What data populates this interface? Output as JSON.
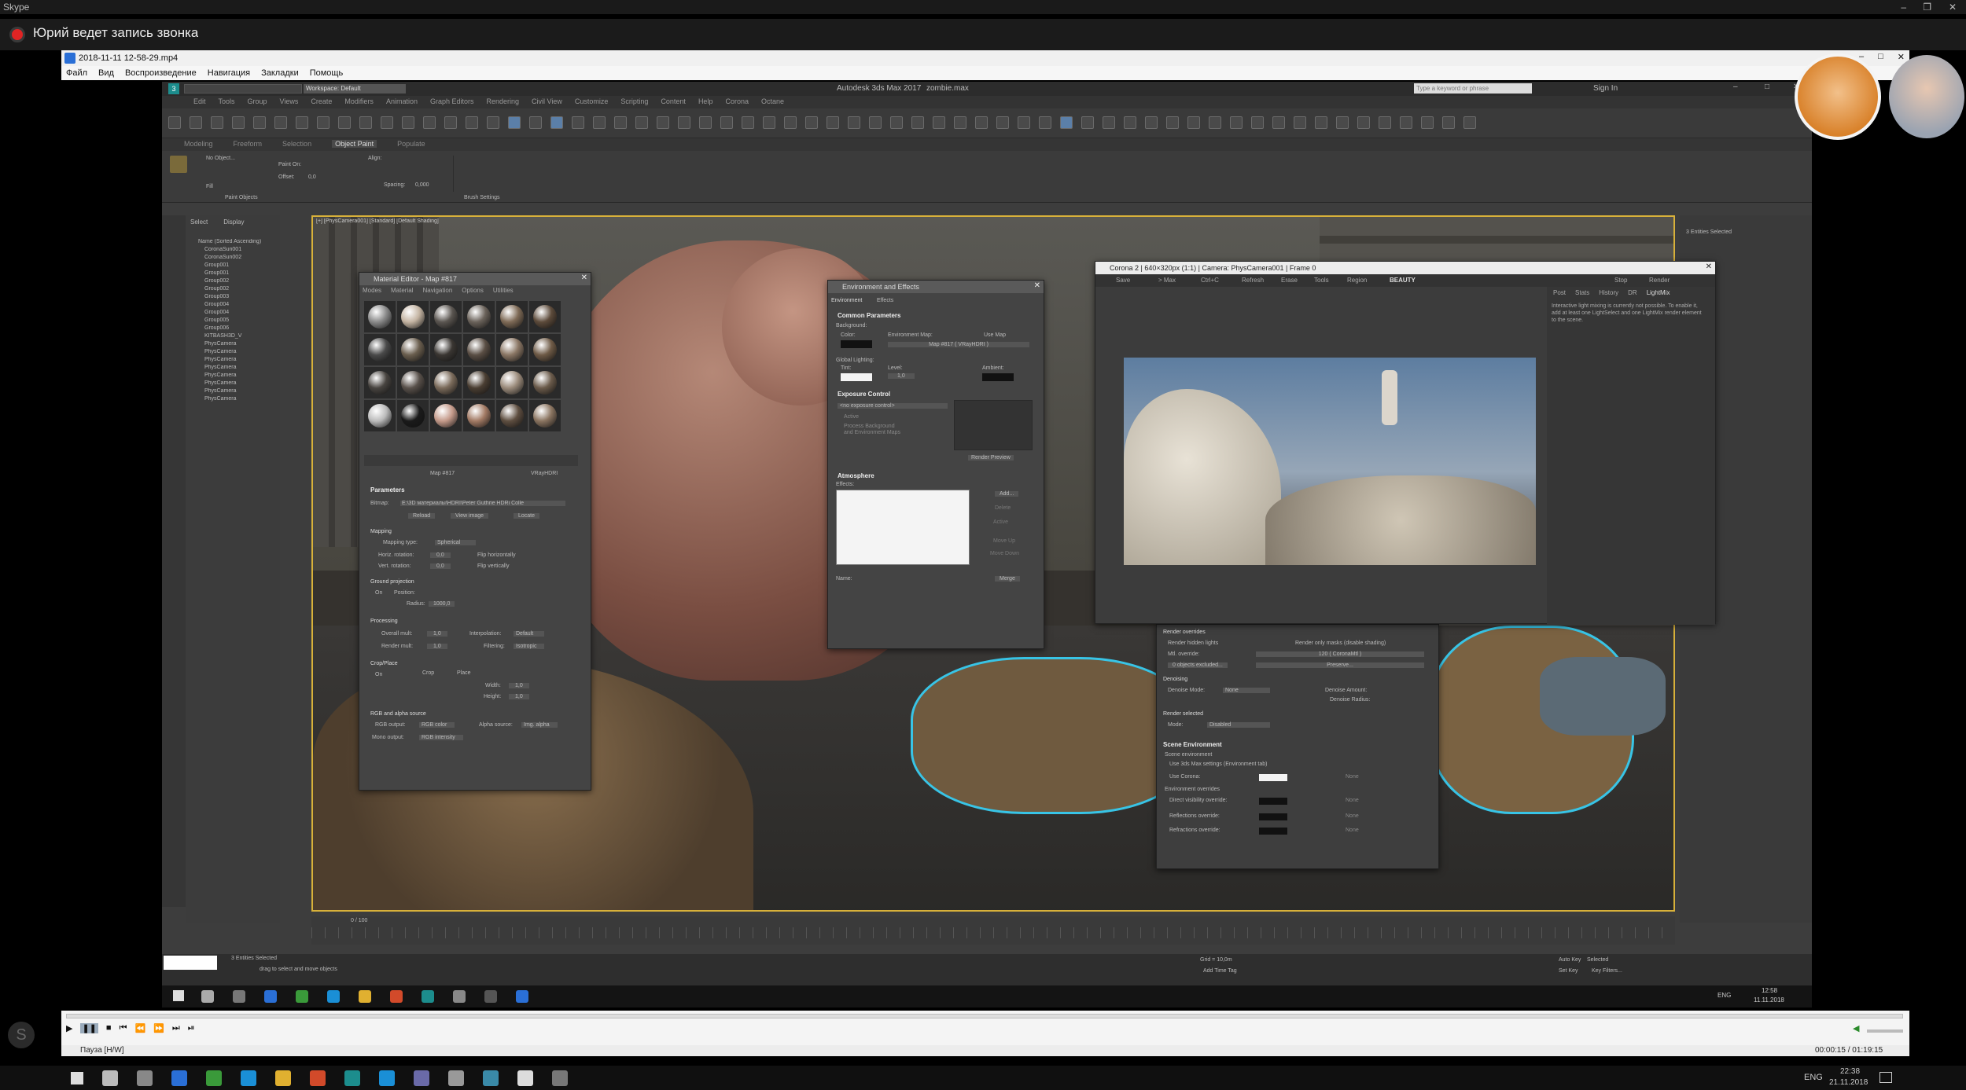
{
  "skype": {
    "title": "Skype",
    "recording_text": "Юрий ведет запись звонка"
  },
  "player": {
    "title": "2018-11-11 12-58-29.mp4",
    "menu": [
      "Файл",
      "Вид",
      "Воспроизведение",
      "Навигация",
      "Закладки",
      "Помощь"
    ],
    "status": "Пауза [H/W]",
    "time": "00:00:15 / 01:19:15"
  },
  "max": {
    "title": "Autodesk 3ds Max 2017",
    "file": "zombie.max",
    "workspace": "Workspace: Default",
    "search_placeholder": "Type a keyword or phrase",
    "sign_in": "Sign In",
    "menu": [
      "Edit",
      "Tools",
      "Group",
      "Views",
      "Create",
      "Modifiers",
      "Animation",
      "Graph Editors",
      "Rendering",
      "Civil View",
      "Customize",
      "Scripting",
      "Content",
      "Help",
      "Corona",
      "Octane"
    ],
    "ribbon_tabs": [
      "Modeling",
      "Freeform",
      "Selection",
      "Object Paint",
      "Populate"
    ],
    "ribbon_labels": {
      "no_object": "No Object...",
      "paint_on": "Paint On:",
      "offset": "Offset:",
      "offset_val": "0,0",
      "fill": "Fill",
      "align": "Align:",
      "spacing": "Spacing:",
      "spacing_val": "0,000",
      "paint_objects": "Paint Objects",
      "brush_settings": "Brush Settings"
    },
    "explorer": {
      "tabs": [
        "Select",
        "Display"
      ],
      "header": "Name (Sorted Ascending)",
      "items": [
        "CoronaSun001",
        "CoronaSun002",
        "Group001",
        "Group001",
        "Group002",
        "Group002",
        "Group003",
        "Group004",
        "Group004",
        "Group005",
        "Group006",
        "KITBASH3D_V",
        "PhysCamera",
        "PhysCamera",
        "PhysCamera",
        "PhysCamera",
        "PhysCamera",
        "PhysCamera",
        "PhysCamera",
        "PhysCamera"
      ]
    },
    "viewport_label": "[+] [PhysCamera001] [Standard] [Default Shading]",
    "status": {
      "selected": "3 Entities Selected",
      "hint": "drag to select and move objects",
      "grid": "Grid = 10,0m",
      "add_time_tag": "Add Time Tag",
      "auto_key": "Auto Key",
      "set_key": "Set Key",
      "selected_dd": "Selected",
      "key_filters": "Key Filters..."
    },
    "timeline_range": "0 / 100",
    "right_panel": {
      "header": "3 Entities Selected"
    }
  },
  "material_editor": {
    "title": "Material Editor - Map #817",
    "menu": [
      "Modes",
      "Material",
      "Navigation",
      "Options",
      "Utilities"
    ],
    "map_name": "Map #817",
    "map_type": "VRayHDRI",
    "section_params": "Parameters",
    "bitmap_label": "Bitmap:",
    "bitmap_path": "E:\\3D материалы\\HDRI\\Peter Guthrie HDRi Colle",
    "buttons": [
      "Reload",
      "View image",
      "Locate"
    ],
    "mapping": "Mapping",
    "mapping_type_label": "Mapping type:",
    "mapping_type": "Spherical",
    "horiz_rot": "Horiz. rotation:",
    "vert_rot": "Vert. rotation:",
    "flip_h": "Flip horizontally",
    "flip_v": "Flip vertically",
    "ground_projection": "Ground projection",
    "on": "On",
    "position": "Position:",
    "radius": "Radius:",
    "radius_val": "1000,0",
    "processing": "Processing",
    "overall_mult": "Overall mult:",
    "render_mult": "Render mult:",
    "interpolation": "Interpolation:",
    "interpolation_val": "Default",
    "filtering": "Filtering:",
    "filtering_val": "Isotropic",
    "crop_place": "Crop/Place",
    "crop": "Crop",
    "place": "Place",
    "width": "Width:",
    "height": "Height:",
    "rgb_alpha": "RGB and alpha source",
    "rgb_output": "RGB output:",
    "rgb_output_val": "RGB color",
    "alpha_source": "Alpha source:",
    "alpha_source_val": "Img. alpha",
    "mono_output": "Mono output:",
    "mono_output_val": "RGB intensity",
    "val_zero": "0,0",
    "val_one": "1,0"
  },
  "env_effects": {
    "title": "Environment and Effects",
    "tabs": [
      "Environment",
      "Effects"
    ],
    "common_params": "Common Parameters",
    "background": "Background:",
    "color": "Color:",
    "env_map": "Environment Map:",
    "use_map": "Use Map",
    "map_btn": "Map #817 ( VRayHDRI )",
    "global_lighting": "Global Lighting:",
    "tint": "Tint:",
    "level": "Level:",
    "level_val": "1,0",
    "ambient": "Ambient:",
    "exposure_control": "Exposure Control",
    "exposure_dd": "<no exposure control>",
    "active": "Active",
    "process_bg": "Process Background",
    "and_env": "and Environment Maps",
    "render_preview": "Render Preview",
    "atmosphere": "Atmosphere",
    "effects": "Effects:",
    "atm_buttons": [
      "Add...",
      "Delete",
      "Active",
      "Move Up",
      "Move Down"
    ],
    "name": "Name:",
    "merge": "Merge"
  },
  "corona": {
    "title": "Corona 2 | 640×320px (1:1) | Camera: PhysCamera001 | Frame 0",
    "toolbar": [
      "Save",
      "> Max",
      "Ctrl+C",
      "Refresh",
      "Erase",
      "Tools",
      "Region",
      "BEAUTY"
    ],
    "stop": "Stop",
    "render": "Render",
    "side_tabs": [
      "Post",
      "Stats",
      "History",
      "DR",
      "LightMix"
    ],
    "lightmix_msg": "Interactive light mixing is currently not possible. To enable it, add at least one LightSelect and one LightMix render element to the scene."
  },
  "render_setup": {
    "render_overrides": "Render overrides",
    "render_hidden": "Render hidden lights",
    "render_only_masks": "Render only masks (disable shading)",
    "mtl_override": "Mtl. override:",
    "mtl_override_val": "120 ( CoronaMtl )",
    "objects_excluded": "0 objects excluded...",
    "preserve": "Preserve...",
    "denoising": "Denoising",
    "denoise_mode": "Denoise Mode:",
    "denoise_mode_val": "None",
    "denoise_amount": "Denoise Amount:",
    "denoise_radius": "Denoise Radius:",
    "render_selected": "Render selected",
    "mode": "Mode:",
    "mode_val": "Disabled",
    "scene_env": "Scene Environment",
    "scene_environment": "Scene environment",
    "use_3ds": "Use 3ds Max settings (Environment tab)",
    "use_corona": "Use Corona:",
    "env_overrides": "Environment overrides",
    "direct_vis": "Direct visibility override:",
    "reflections": "Reflections override:",
    "refractions": "Refractions override:",
    "none": "None"
  },
  "inner_clock": {
    "time": "12:58",
    "date": "11.11.2018",
    "lang": "ENG"
  },
  "outer_clock": {
    "time": "22:38",
    "date": "21.11.2018",
    "lang": "ENG"
  },
  "colors": {
    "recording": "#e02424",
    "viewport_border": "#d8b13a",
    "selection_outline": "#38c4e6",
    "max_bg": "#3d3d3d"
  }
}
